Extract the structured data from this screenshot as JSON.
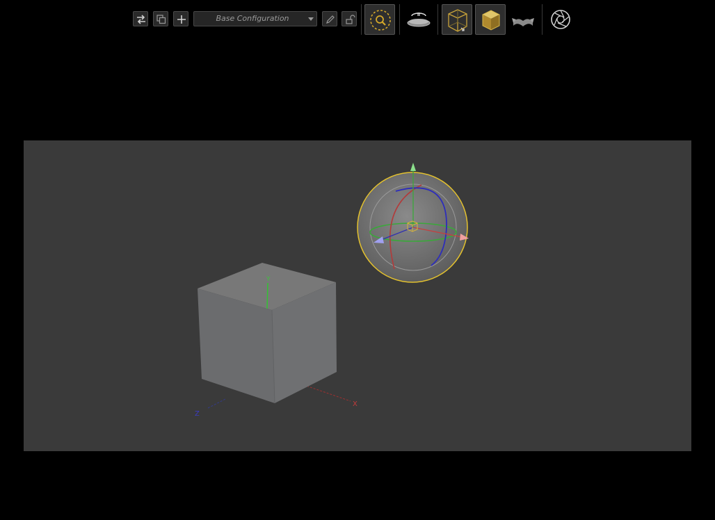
{
  "toolbar": {
    "configuration": {
      "selected": "Base Configuration"
    },
    "icons": [
      "swap-icon",
      "duplicate-icon",
      "add-icon",
      "pencil-icon",
      "lock-icon",
      "zoom-fit-icon",
      "turntable-icon",
      "wireframe-cube-icon",
      "solid-cube-icon",
      "flip-icon",
      "camera-aperture-icon"
    ]
  },
  "viewport": {
    "axis_labels": {
      "x": "X",
      "y": "Y",
      "z": "Z"
    },
    "colors": {
      "background": "#3a3a3a",
      "cube": "#6d6e70",
      "selection": "#e3c12e",
      "x_axis": "#c23b3b",
      "y_axis": "#3ea83e",
      "z_axis": "#3b3bc2"
    }
  }
}
